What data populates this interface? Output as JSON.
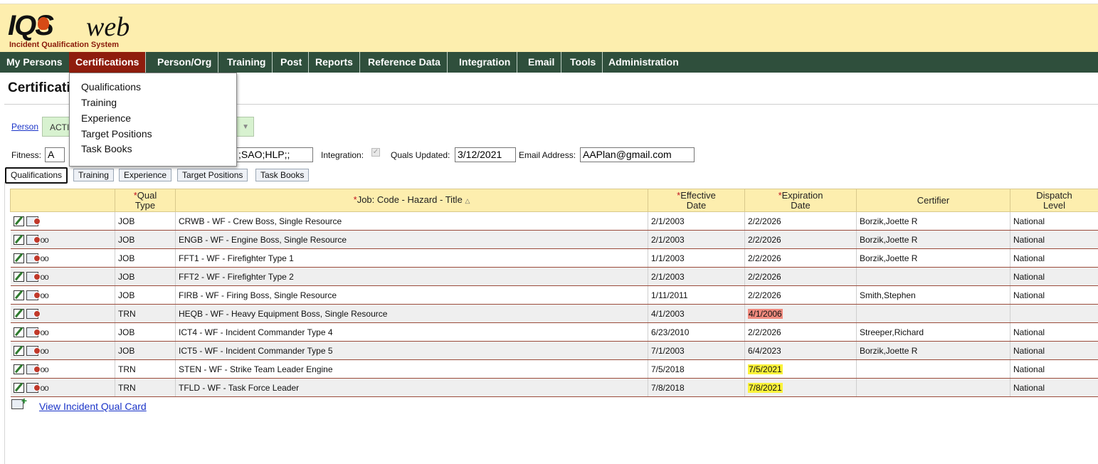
{
  "logo": {
    "brand_main": "IQS",
    "brand_suffix": "web",
    "subtitle": "Incident Qualification System"
  },
  "nav": {
    "items": [
      "My Persons",
      "Certifications",
      "Person/Org",
      "Training",
      "Post",
      "Reports",
      "Reference Data",
      "Integration",
      "Email",
      "Tools",
      "Administration"
    ],
    "active": "Certifications"
  },
  "dropdown": {
    "items": [
      "Qualifications",
      "Training",
      "Experience",
      "Target Positions",
      "Task Books"
    ]
  },
  "page": {
    "title": "Certifications"
  },
  "person": {
    "link_label": "Person",
    "selected": "ACTI"
  },
  "fields": {
    "fitness_label": "Fitness:",
    "fitness_value": "A",
    "codes_value": ";SAO;HLP;;",
    "integration_label": "Integration:",
    "quals_updated_label": "Quals Updated:",
    "quals_updated_value": "3/12/2021",
    "email_label": "Email Address:",
    "email_value": "AAPlan@gmail.com"
  },
  "tabs": [
    "Qualifications",
    "Training",
    "Experience",
    "Target Positions",
    "Task Books"
  ],
  "table": {
    "headers": {
      "qual_type_1": "Qual",
      "qual_type_2": "Type",
      "job": "Job: Code - Hazard - Title",
      "sort_indicator": "△",
      "effective_1": "Effective",
      "effective_2": "Date",
      "expiration_1": "Expiration",
      "expiration_2": "Date",
      "certifier": "Certifier",
      "dispatch_1": "Dispatch",
      "dispatch_2": "Level",
      "required_mark": "*"
    },
    "rows": [
      {
        "type": "JOB",
        "job": "CRWB - WF - Crew Boss, Single Resource",
        "effective": "2/1/2003",
        "expiration": "2/2/2026",
        "certifier": "Borzik,Joette R",
        "dispatch": "National"
      },
      {
        "type": "JOB",
        "job": "ENGB - WF - Engine Boss, Single Resource",
        "effective": "2/1/2003",
        "expiration": "2/2/2026",
        "certifier": "Borzik,Joette R",
        "dispatch": "National"
      },
      {
        "type": "JOB",
        "job": "FFT1 - WF - Firefighter Type 1",
        "effective": "1/1/2003",
        "expiration": "2/2/2026",
        "certifier": "Borzik,Joette R",
        "dispatch": "National"
      },
      {
        "type": "JOB",
        "job": "FFT2 - WF - Firefighter Type 2",
        "effective": "2/1/2003",
        "expiration": "2/2/2026",
        "certifier": "",
        "dispatch": "National"
      },
      {
        "type": "JOB",
        "job": "FIRB - WF - Firing Boss, Single Resource",
        "effective": "1/11/2011",
        "expiration": "2/2/2026",
        "certifier": "Smith,Stephen",
        "dispatch": "National"
      },
      {
        "type": "TRN",
        "job": "HEQB - WF - Heavy Equipment Boss, Single Resource",
        "effective": "4/1/2003",
        "expiration": "4/1/2006",
        "certifier": "",
        "dispatch": ""
      },
      {
        "type": "JOB",
        "job": "ICT4 - WF - Incident Commander Type 4",
        "effective": "6/23/2010",
        "expiration": "2/2/2026",
        "certifier": "Streeper,Richard",
        "dispatch": "National"
      },
      {
        "type": "JOB",
        "job": "ICT5 - WF - Incident Commander Type 5",
        "effective": "7/1/2003",
        "expiration": "6/4/2023",
        "certifier": "Borzik,Joette R",
        "dispatch": "National"
      },
      {
        "type": "TRN",
        "job": "STEN - WF - Strike Team Leader Engine",
        "effective": "7/5/2018",
        "expiration": "7/5/2021",
        "certifier": "",
        "dispatch": "National"
      },
      {
        "type": "TRN",
        "job": "TFLD - WF - Task Force Leader",
        "effective": "7/8/2018",
        "expiration": "7/8/2021",
        "certifier": "",
        "dispatch": "National"
      }
    ]
  },
  "footer": {
    "qual_card_link": "View Incident Qual Card"
  }
}
